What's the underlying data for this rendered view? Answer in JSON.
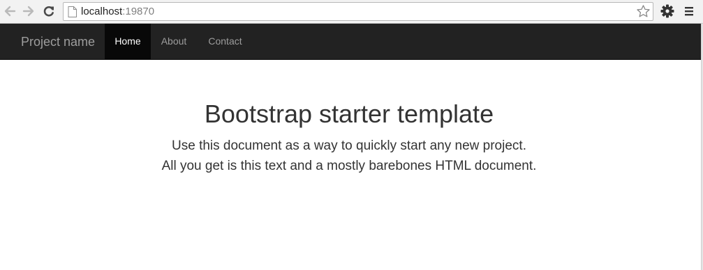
{
  "browser": {
    "url_host": "localhost",
    "url_port": ":19870"
  },
  "navbar": {
    "brand": "Project name",
    "items": [
      {
        "label": "Home",
        "active": true
      },
      {
        "label": "About",
        "active": false
      },
      {
        "label": "Contact",
        "active": false
      }
    ]
  },
  "content": {
    "title": "Bootstrap starter template",
    "lead_line_1": "Use this document as a way to quickly start any new project.",
    "lead_line_2": "All you get is this text and a mostly barebones HTML document."
  },
  "icons": {
    "back": "arrow-left-icon",
    "forward": "arrow-right-icon",
    "reload": "reload-icon",
    "page": "page-icon",
    "bookmark": "star-icon",
    "settings": "gear-icon",
    "menu": "hamburger-menu-icon"
  },
  "colors": {
    "navbar_bg": "#222222",
    "navbar_active_bg": "#080808",
    "nav_text": "#9d9d9d",
    "nav_active_text": "#ffffff",
    "body_text": "#333333"
  }
}
